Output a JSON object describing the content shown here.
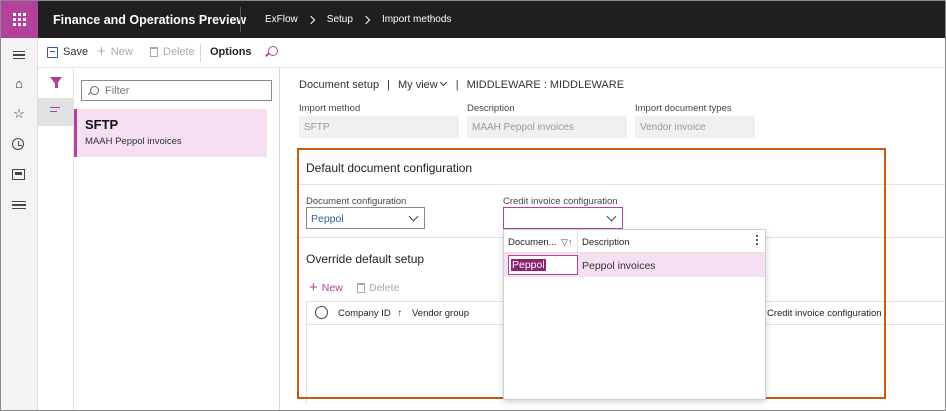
{
  "topbar": {
    "app_title": "Finance and Operations Preview",
    "breadcrumbs": [
      "ExFlow",
      "Setup",
      "Import methods"
    ]
  },
  "actionbar": {
    "save": "Save",
    "new": "New",
    "delete": "Delete",
    "options": "Options"
  },
  "listpane": {
    "filter_placeholder": "Filter",
    "items": [
      {
        "title": "SFTP",
        "subtitle": "MAAH Peppol invoices"
      }
    ]
  },
  "header": {
    "document_setup": "Document setup",
    "my_view": "My view",
    "sep": "|",
    "record": "MIDDLEWARE : MIDDLEWARE"
  },
  "fields": {
    "import_method": {
      "label": "Import method",
      "value": "SFTP"
    },
    "description": {
      "label": "Description",
      "value": "MAAH Peppol invoices"
    },
    "import_doc_types": {
      "label": "Import document types",
      "value": "Vendor invoice"
    }
  },
  "default_config": {
    "title": "Default document configuration",
    "document_configuration": {
      "label": "Document configuration",
      "value": "Peppol"
    },
    "credit_invoice_configuration": {
      "label": "Credit invoice configuration",
      "value": ""
    }
  },
  "override": {
    "title": "Override default setup",
    "new": "New",
    "delete": "Delete",
    "columns": [
      "Company ID",
      "Vendor group",
      "Credit invoice configuration"
    ],
    "sort_indicator": "↑"
  },
  "dropdown": {
    "col_document": "Documen...",
    "col_description": "Description",
    "filter_glyph": "▽↑",
    "rows": [
      {
        "document": "Peppol",
        "description": "Peppol invoices"
      }
    ]
  },
  "colors": {
    "brand": "#b2419b",
    "topbar": "#1f1f1f",
    "highlight_border": "#c55a11",
    "selected_row": "#f5dff1"
  }
}
